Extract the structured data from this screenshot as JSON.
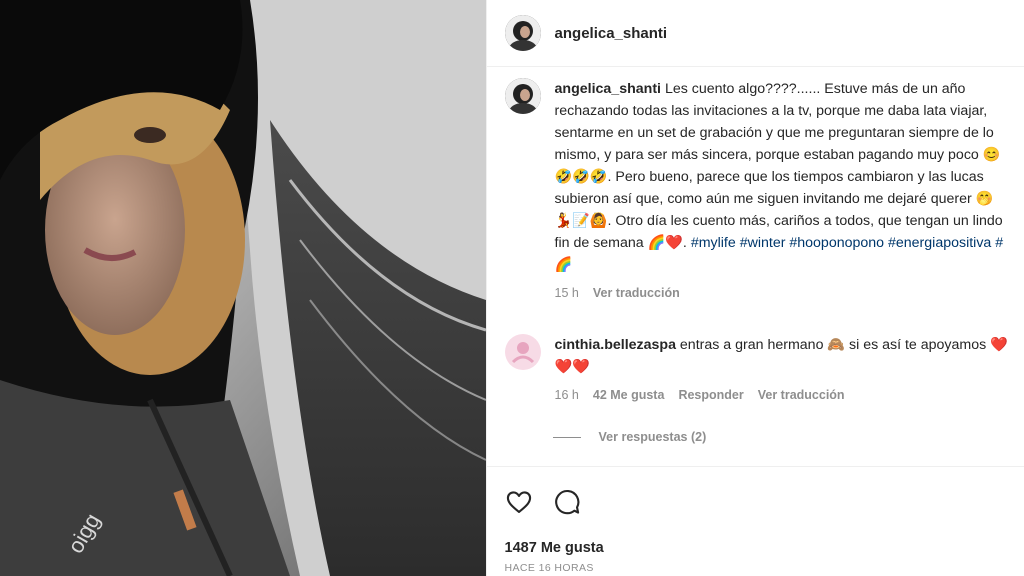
{
  "post": {
    "username": "angelica_shanti",
    "caption": {
      "username": "angelica_shanti",
      "text": "Les cuento algo????...... Estuve más de un año rechazando todas las invitaciones a la tv, porque me daba lata viajar, sentarme en un set de grabación y que me preguntaran siempre de lo mismo, y para ser más sincera, porque estaban pagando muy poco 😊🤣🤣🤣. Pero bueno, parece que los tiempos cambiaron y las lucas subieron así que, como aún me siguen invitando me dejaré querer 🤭💃📝🙆. Otro día les cuento más, cariños a todos, que tengan un lindo fin de semana 🌈❤️. ",
      "hashtags": "#mylife #winter #hooponopono #energiapositiva #🌈",
      "time": "15 h",
      "translate": "Ver traducción"
    },
    "comment": {
      "username": "cinthia.bellezaspa",
      "text": "entras a gran hermano 🙈 si es así te apoyamos ❤️❤️❤️",
      "time": "16 h",
      "likes": "42 Me gusta",
      "reply": "Responder",
      "translate": "Ver traducción",
      "view_replies": "Ver respuestas (2)"
    },
    "likes": "1487 Me gusta",
    "time_ago": "HACE 16 HORAS"
  },
  "icons": {
    "like": "heart-icon",
    "comment": "comment-bubble-icon"
  }
}
